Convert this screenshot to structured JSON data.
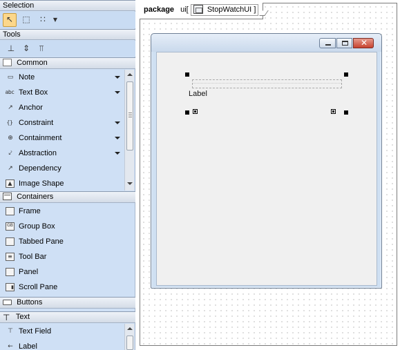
{
  "palette": {
    "sections": {
      "selection": "Selection",
      "tools": "Tools",
      "common": "Common",
      "containers": "Containers",
      "buttons": "Buttons",
      "text": "Text"
    },
    "selection_tools": [
      {
        "icon": "arrow-pointer-icon",
        "selected": true
      },
      {
        "icon": "rectangle-select-icon",
        "selected": false
      },
      {
        "icon": "multi-select-icon",
        "selected": false
      }
    ],
    "common_items": [
      {
        "label": "Note",
        "icon": "note-icon",
        "has_dropdown": true
      },
      {
        "label": "Text Box",
        "icon": "text-box-icon",
        "icon_text": "abc",
        "has_dropdown": true
      },
      {
        "label": "Anchor",
        "icon": "anchor-icon",
        "has_dropdown": false
      },
      {
        "label": "Constraint",
        "icon": "constraint-icon",
        "icon_text": "{}",
        "has_dropdown": true
      },
      {
        "label": "Containment",
        "icon": "containment-icon",
        "has_dropdown": true
      },
      {
        "label": "Abstraction",
        "icon": "abstraction-icon",
        "has_dropdown": true
      },
      {
        "label": "Dependency",
        "icon": "dependency-icon",
        "has_dropdown": false
      },
      {
        "label": "Image Shape",
        "icon": "image-shape-icon",
        "has_dropdown": false
      }
    ],
    "container_items": [
      {
        "label": "Frame",
        "icon": "frame-icon"
      },
      {
        "label": "Group Box",
        "icon": "group-box-icon"
      },
      {
        "label": "Tabbed Pane",
        "icon": "tabbed-pane-icon"
      },
      {
        "label": "Tool Bar",
        "icon": "tool-bar-icon"
      },
      {
        "label": "Panel",
        "icon": "panel-icon"
      },
      {
        "label": "Scroll Pane",
        "icon": "scroll-pane-icon"
      }
    ],
    "text_items": [
      {
        "label": "Text Field",
        "icon": "text-field-icon"
      },
      {
        "label": "Label",
        "icon": "label-icon"
      }
    ]
  },
  "diagram": {
    "keyword": "package",
    "package_name": "ui",
    "open_bracket": "[",
    "diagram_name": "StopWatchUI",
    "close_bracket": "]",
    "window": {
      "label_text": "Label"
    }
  },
  "colors": {
    "palette_bg": "#cfe0f5",
    "selected_tool": "#fcd78a",
    "close_button": "#c7432f"
  }
}
